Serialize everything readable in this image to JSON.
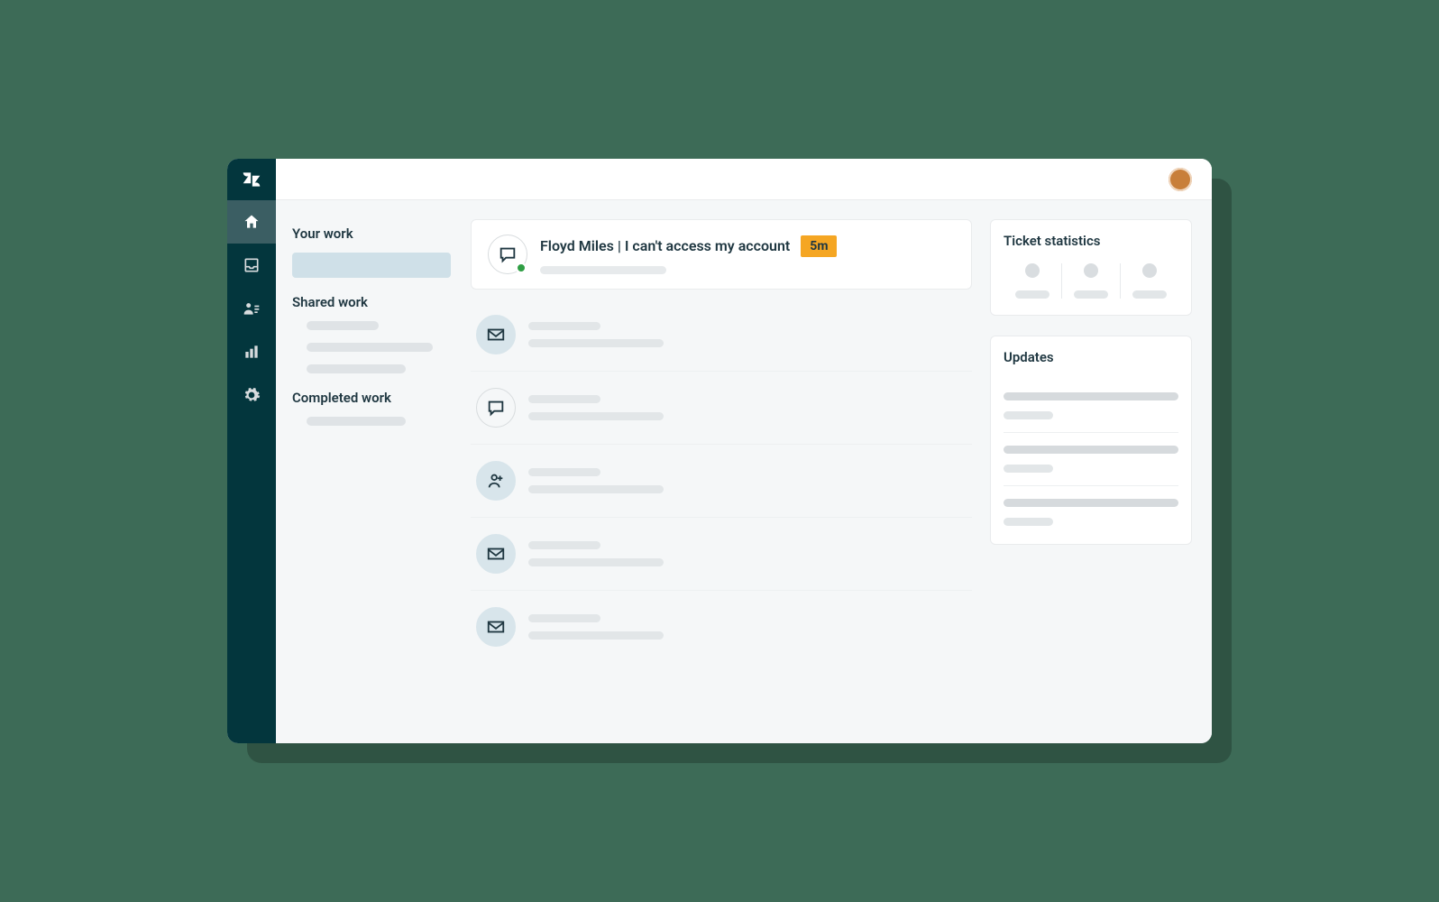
{
  "nav": {
    "items": [
      {
        "name": "home",
        "active": true
      },
      {
        "name": "inbox",
        "active": false
      },
      {
        "name": "users",
        "active": false
      },
      {
        "name": "reports",
        "active": false
      },
      {
        "name": "settings",
        "active": false
      }
    ]
  },
  "left": {
    "your_work_label": "Your work",
    "shared_work_label": "Shared work",
    "completed_work_label": "Completed work"
  },
  "ticket": {
    "author": "Floyd Miles",
    "separator": " | ",
    "subject": "I can't access my account",
    "age_badge": "5m",
    "status": "online"
  },
  "rows": [
    {
      "icon": "mail",
      "style": "filled"
    },
    {
      "icon": "chat",
      "style": "outline"
    },
    {
      "icon": "user-plus",
      "style": "filled"
    },
    {
      "icon": "mail",
      "style": "filled"
    },
    {
      "icon": "mail",
      "style": "filled"
    }
  ],
  "right": {
    "stats_label": "Ticket statistics",
    "updates_label": "Updates"
  },
  "colors": {
    "page_bg": "#3d6b57",
    "nav_bg": "#03363d",
    "badge_bg": "#f5a623",
    "status_online": "#2f9e44",
    "text_dark": "#1f3741"
  }
}
